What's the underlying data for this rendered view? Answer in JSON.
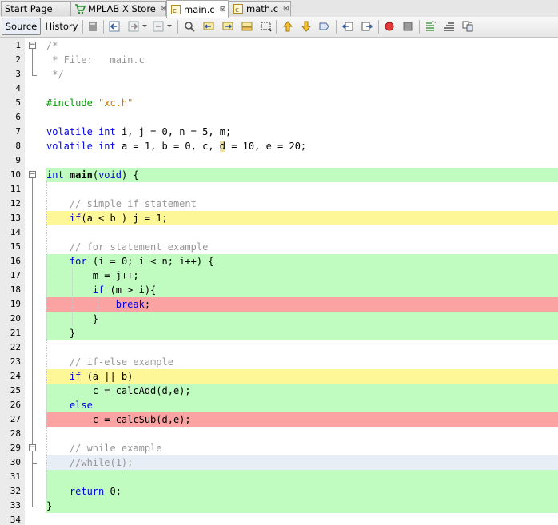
{
  "tabs": [
    {
      "label": "Start Page",
      "icon": "none"
    },
    {
      "label": "MPLAB X Store",
      "icon": "cart-icon"
    },
    {
      "label": "main.c",
      "icon": "c-file-icon"
    },
    {
      "label": "math.c",
      "icon": "c-file-icon"
    }
  ],
  "active_tab": "main.c",
  "view_tabs": {
    "source": "Source",
    "history": "History"
  },
  "colors": {
    "green_highlight": "#c0fcc0",
    "yellow_highlight": "#fdf797",
    "red_highlight": "#fba3a3",
    "keyword": "#0000e6",
    "comment": "#969696",
    "preprocessor": "#009900",
    "string": "#ce7b00"
  },
  "code_lines": [
    {
      "n": "1",
      "text": "/*"
    },
    {
      "n": "2",
      "text": " * File:   main.c"
    },
    {
      "n": "3",
      "text": " */"
    },
    {
      "n": "4",
      "text": ""
    },
    {
      "n": "5",
      "text": "#include \"xc.h\""
    },
    {
      "n": "6",
      "text": ""
    },
    {
      "n": "7",
      "text": "volatile int i, j = 0, n = 5, m;"
    },
    {
      "n": "8",
      "text": "volatile int a = 1, b = 0, c, d = 10, e = 20;"
    },
    {
      "n": "9",
      "text": ""
    },
    {
      "n": "10",
      "text": "int main(void) {"
    },
    {
      "n": "11",
      "text": ""
    },
    {
      "n": "12",
      "text": "    // simple if statement"
    },
    {
      "n": "13",
      "text": "    if(a < b ) j = 1;"
    },
    {
      "n": "14",
      "text": ""
    },
    {
      "n": "15",
      "text": "    // for statement example"
    },
    {
      "n": "16",
      "text": "    for (i = 0; i < n; i++) {"
    },
    {
      "n": "17",
      "text": "        m = j++;"
    },
    {
      "n": "18",
      "text": "        if (m > i){"
    },
    {
      "n": "19",
      "text": "            break;"
    },
    {
      "n": "20",
      "text": "        }"
    },
    {
      "n": "21",
      "text": "    }"
    },
    {
      "n": "22",
      "text": ""
    },
    {
      "n": "23",
      "text": "    // if-else example"
    },
    {
      "n": "24",
      "text": "    if (a || b)"
    },
    {
      "n": "25",
      "text": "        c = calcAdd(d,e);"
    },
    {
      "n": "26",
      "text": "    else"
    },
    {
      "n": "27",
      "text": "        c = calcSub(d,e);"
    },
    {
      "n": "28",
      "text": ""
    },
    {
      "n": "29",
      "text": "    // while example"
    },
    {
      "n": "30",
      "text": "    //while(1);"
    },
    {
      "n": "31",
      "text": ""
    },
    {
      "n": "32",
      "text": "    return 0;"
    },
    {
      "n": "33",
      "text": "}"
    },
    {
      "n": "34",
      "text": ""
    }
  ],
  "line_highlights": {
    "10": "green",
    "13": "yellow",
    "16": "green",
    "17": "green",
    "18": "green",
    "19": "red",
    "20": "green",
    "21": "green",
    "24": "yellow",
    "25": "green",
    "26": "green",
    "27": "red",
    "30": "blue",
    "31": "green",
    "32": "green",
    "33": "green"
  },
  "toolbar_icons": [
    "last-edit-icon",
    "back-icon",
    "forward-icon",
    "find-icon",
    "find-previous-icon",
    "find-next-icon",
    "toggle-highlight-icon",
    "rectangular-selection-icon",
    "previous-bookmark-icon",
    "next-bookmark-icon",
    "toggle-bookmark-icon",
    "shift-left-icon",
    "shift-right-icon",
    "record-macro-icon",
    "stop-macro-icon",
    "comment-icon",
    "uncomment-icon",
    "diff-icon"
  ]
}
